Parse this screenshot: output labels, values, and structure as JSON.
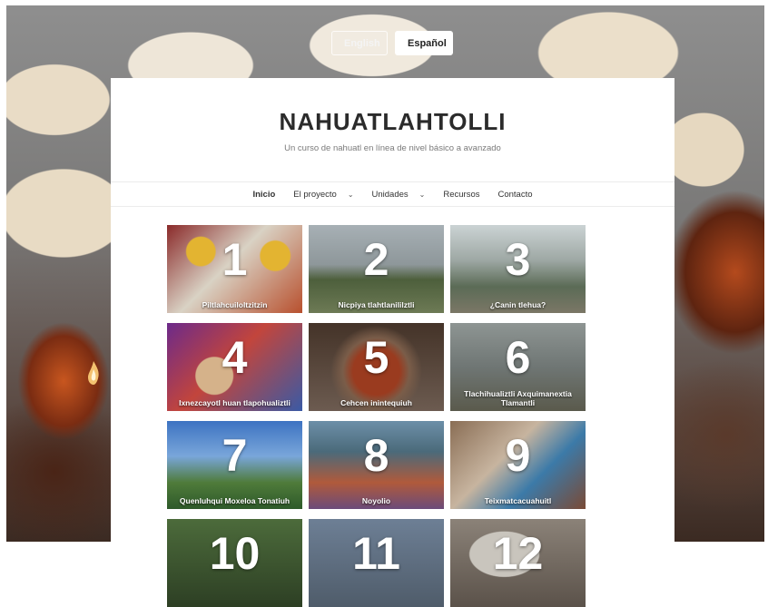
{
  "language_switch": {
    "english_label": "English",
    "spanish_label": "Español"
  },
  "header": {
    "title": "NAHUATLAHTOLLI",
    "subtitle": "Un curso de nahuatl en línea de nivel básico a avanzado"
  },
  "nav": {
    "items": [
      {
        "label": "Inicio",
        "active": true,
        "dropdown": false
      },
      {
        "label": "El proyecto",
        "dropdown": true
      },
      {
        "label": "Unidades",
        "dropdown": true
      },
      {
        "label": "Recursos",
        "dropdown": false
      },
      {
        "label": "Contacto",
        "dropdown": false
      }
    ],
    "dropdown_icon": "chevron-down-icon"
  },
  "units": [
    {
      "number": "1",
      "title": "Piltlahcuiloltzitzin"
    },
    {
      "number": "2",
      "title": "Nicpiya tlahtlanililztli"
    },
    {
      "number": "3",
      "title": "¿Canin tlehua?"
    },
    {
      "number": "4",
      "title": "Ixnezcayotl huan tlapohualiztli"
    },
    {
      "number": "5",
      "title": "Cehcen inintequiuh"
    },
    {
      "number": "6",
      "title": "Tlachihualiztli Axquimanextia Tlamantli"
    },
    {
      "number": "7",
      "title": "Quenluhqui Moxeloa Tonatiuh"
    },
    {
      "number": "8",
      "title": "Noyolio"
    },
    {
      "number": "9",
      "title": "Teixmatcacuahuitl"
    },
    {
      "number": "10",
      "title": ""
    },
    {
      "number": "11",
      "title": ""
    },
    {
      "number": "12",
      "title": ""
    }
  ]
}
